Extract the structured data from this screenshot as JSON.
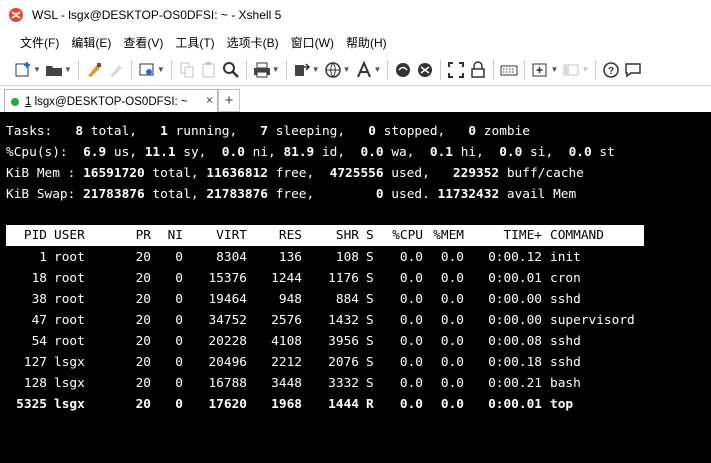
{
  "window": {
    "title": "WSL - lsgx@DESKTOP-OS0DFSI: ~ - Xshell 5"
  },
  "menu": [
    "文件(F)",
    "编辑(E)",
    "查看(V)",
    "工具(T)",
    "选项卡(B)",
    "窗口(W)",
    "帮助(H)"
  ],
  "toolbar": {
    "icons": [
      "new-session-icon",
      "open-folder-icon",
      "reconnect-icon",
      "disconnect-icon",
      "properties-icon",
      "copy-icon",
      "paste-icon",
      "find-icon",
      "print-icon",
      "transfer-icon",
      "globe-icon",
      "font-icon",
      "xftp-icon",
      "xshell-icon",
      "fullscreen-icon",
      "lock-icon",
      "keyboard-icon",
      "add-tab-icon",
      "layout-icon",
      "help-icon",
      "chat-icon"
    ]
  },
  "tabs": [
    {
      "number": "1",
      "label": "lsgx@DESKTOP-OS0DFSI: ~",
      "status_color": "#27a83a"
    }
  ],
  "summary": {
    "tasks": {
      "label": "Tasks:",
      "total": "8",
      "running": "1",
      "sleeping": "7",
      "stopped": "0",
      "zombie": "0"
    },
    "cpu": {
      "label": "%Cpu(s):",
      "us": "6.9",
      "sy": "11.1",
      "ni": "0.0",
      "id": "81.9",
      "wa": "0.0",
      "hi": "0.1",
      "si": "0.0",
      "st": "0.0"
    },
    "mem": {
      "label": "KiB Mem :",
      "total": "16591720",
      "free": "11636812",
      "used": "4725556",
      "buff_cache": "229352"
    },
    "swap": {
      "label": "KiB Swap:",
      "total": "21783876",
      "free": "21783876",
      "used": "0",
      "avail": "11732432"
    }
  },
  "process_table": {
    "columns": [
      "PID",
      "USER",
      "PR",
      "NI",
      "VIRT",
      "RES",
      "SHR",
      "S",
      "%CPU",
      "%MEM",
      "TIME+",
      "COMMAND"
    ],
    "rows": [
      {
        "pid": "1",
        "user": "root",
        "pr": "20",
        "ni": "0",
        "virt": "8304",
        "res": "136",
        "shr": "108",
        "s": "S",
        "cpu": "0.0",
        "mem": "0.0",
        "time": "0:00.12",
        "cmd": "init",
        "bold": false
      },
      {
        "pid": "18",
        "user": "root",
        "pr": "20",
        "ni": "0",
        "virt": "15376",
        "res": "1244",
        "shr": "1176",
        "s": "S",
        "cpu": "0.0",
        "mem": "0.0",
        "time": "0:00.01",
        "cmd": "cron",
        "bold": false
      },
      {
        "pid": "38",
        "user": "root",
        "pr": "20",
        "ni": "0",
        "virt": "19464",
        "res": "948",
        "shr": "884",
        "s": "S",
        "cpu": "0.0",
        "mem": "0.0",
        "time": "0:00.00",
        "cmd": "sshd",
        "bold": false
      },
      {
        "pid": "47",
        "user": "root",
        "pr": "20",
        "ni": "0",
        "virt": "34752",
        "res": "2576",
        "shr": "1432",
        "s": "S",
        "cpu": "0.0",
        "mem": "0.0",
        "time": "0:00.00",
        "cmd": "supervisord",
        "bold": false
      },
      {
        "pid": "54",
        "user": "root",
        "pr": "20",
        "ni": "0",
        "virt": "20228",
        "res": "4108",
        "shr": "3956",
        "s": "S",
        "cpu": "0.0",
        "mem": "0.0",
        "time": "0:00.08",
        "cmd": "sshd",
        "bold": false
      },
      {
        "pid": "127",
        "user": "lsgx",
        "pr": "20",
        "ni": "0",
        "virt": "20496",
        "res": "2212",
        "shr": "2076",
        "s": "S",
        "cpu": "0.0",
        "mem": "0.0",
        "time": "0:00.18",
        "cmd": "sshd",
        "bold": false
      },
      {
        "pid": "128",
        "user": "lsgx",
        "pr": "20",
        "ni": "0",
        "virt": "16788",
        "res": "3448",
        "shr": "3332",
        "s": "S",
        "cpu": "0.0",
        "mem": "0.0",
        "time": "0:00.21",
        "cmd": "bash",
        "bold": false
      },
      {
        "pid": "5325",
        "user": "lsgx",
        "pr": "20",
        "ni": "0",
        "virt": "17620",
        "res": "1968",
        "shr": "1444",
        "s": "R",
        "cpu": "0.0",
        "mem": "0.0",
        "time": "0:00.01",
        "cmd": "top",
        "bold": true
      }
    ]
  }
}
